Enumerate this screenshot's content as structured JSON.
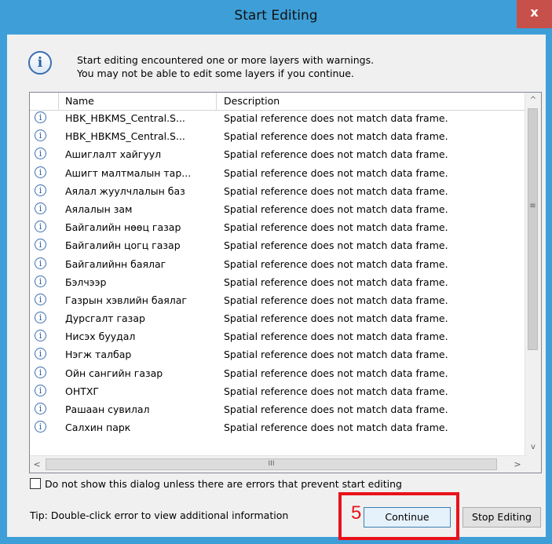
{
  "dialog": {
    "title": "Start Editing",
    "close_label": "x",
    "info_glyph": "i",
    "message_line1": "Start editing encountered one or more layers with warnings.",
    "message_line2": "You may not be able to edit some layers if you continue."
  },
  "table": {
    "columns": {
      "name": "Name",
      "description": "Description"
    },
    "rows": [
      {
        "name": "HBK_HBKMS_Central.S...",
        "description": "Spatial reference does not match data frame."
      },
      {
        "name": "HBK_HBKMS_Central.S...",
        "description": "Spatial reference does not match data frame."
      },
      {
        "name": "Ашиглалт хайгуул",
        "description": "Spatial reference does not match data frame."
      },
      {
        "name": "Ашигт малтмалын тар...",
        "description": "Spatial reference does not match data frame."
      },
      {
        "name": "Аялал жуулчлалын баз",
        "description": "Spatial reference does not match data frame."
      },
      {
        "name": "Аялалын зам",
        "description": "Spatial reference does not match data frame."
      },
      {
        "name": "Байгалийн нөөц газар",
        "description": "Spatial reference does not match data frame."
      },
      {
        "name": "Байгалийн цогц газар",
        "description": "Spatial reference does not match data frame."
      },
      {
        "name": "Байгалийнн баялаг",
        "description": "Spatial reference does not match data frame."
      },
      {
        "name": "Бэлчээр",
        "description": "Spatial reference does not match data frame."
      },
      {
        "name": "Газрын хэвлийн баялаг",
        "description": "Spatial reference does not match data frame."
      },
      {
        "name": "Дурсгалт газар",
        "description": "Spatial reference does not match data frame."
      },
      {
        "name": "Нисэх буудал",
        "description": "Spatial reference does not match data frame."
      },
      {
        "name": "Нэгж талбар",
        "description": "Spatial reference does not match data frame."
      },
      {
        "name": "Ойн сангийн газар",
        "description": "Spatial reference does not match data frame."
      },
      {
        "name": "ОНТХГ",
        "description": "Spatial reference does not match data frame."
      },
      {
        "name": "Рашаан сувилал",
        "description": "Spatial reference does not match data frame."
      },
      {
        "name": "Салхин парк",
        "description": "Spatial reference does not match data frame."
      }
    ],
    "scroll_up": "^",
    "scroll_down": "v",
    "scroll_grip": "≡",
    "scroll_left": "<",
    "scroll_right": ">",
    "hscroll_grip": "III"
  },
  "footer": {
    "checkbox_label": "Do not show this dialog unless there are errors that prevent start editing",
    "tip": "Tip: Double-click error to view additional information",
    "continue_label": "Continue",
    "stop_label": "Stop Editing"
  },
  "annotation": {
    "step_number": "5",
    "color": "#e8131a"
  }
}
